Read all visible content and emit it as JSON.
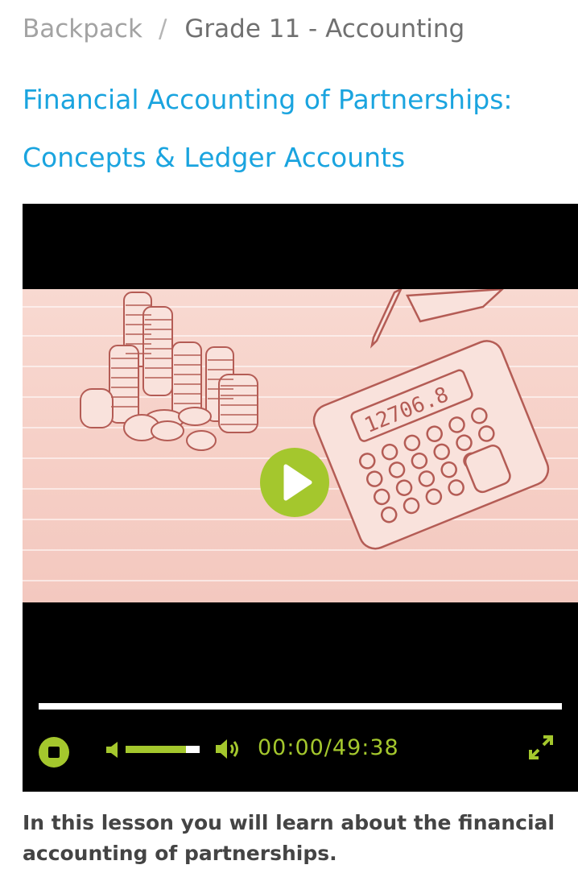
{
  "breadcrumb": {
    "link": "Backpack",
    "separator": "/",
    "current": "Grade 11 - Accounting"
  },
  "lesson": {
    "title": "Financial Accounting of Partnerships: Concepts & Ledger Accounts",
    "intro": "In this lesson you will learn about the financial accounting of partnerships."
  },
  "video": {
    "thumbnail_subject": "coins and calculator sketch",
    "calculator_display": "12706.8",
    "time_display": "00:00/49:38",
    "current_time": "00:00",
    "duration": "49:38",
    "progress": 0,
    "volume": 0.82,
    "icons": {
      "play": "play-icon",
      "stop": "stop-icon",
      "mute": "speaker-mute-icon",
      "volume": "speaker-volume-icon",
      "fullscreen": "fullscreen-icon"
    }
  },
  "colors": {
    "accent_green": "#a4c72d",
    "title_blue": "#1aa4df",
    "breadcrumb_gray": "#a3a3a3",
    "text_dark": "#444444"
  }
}
